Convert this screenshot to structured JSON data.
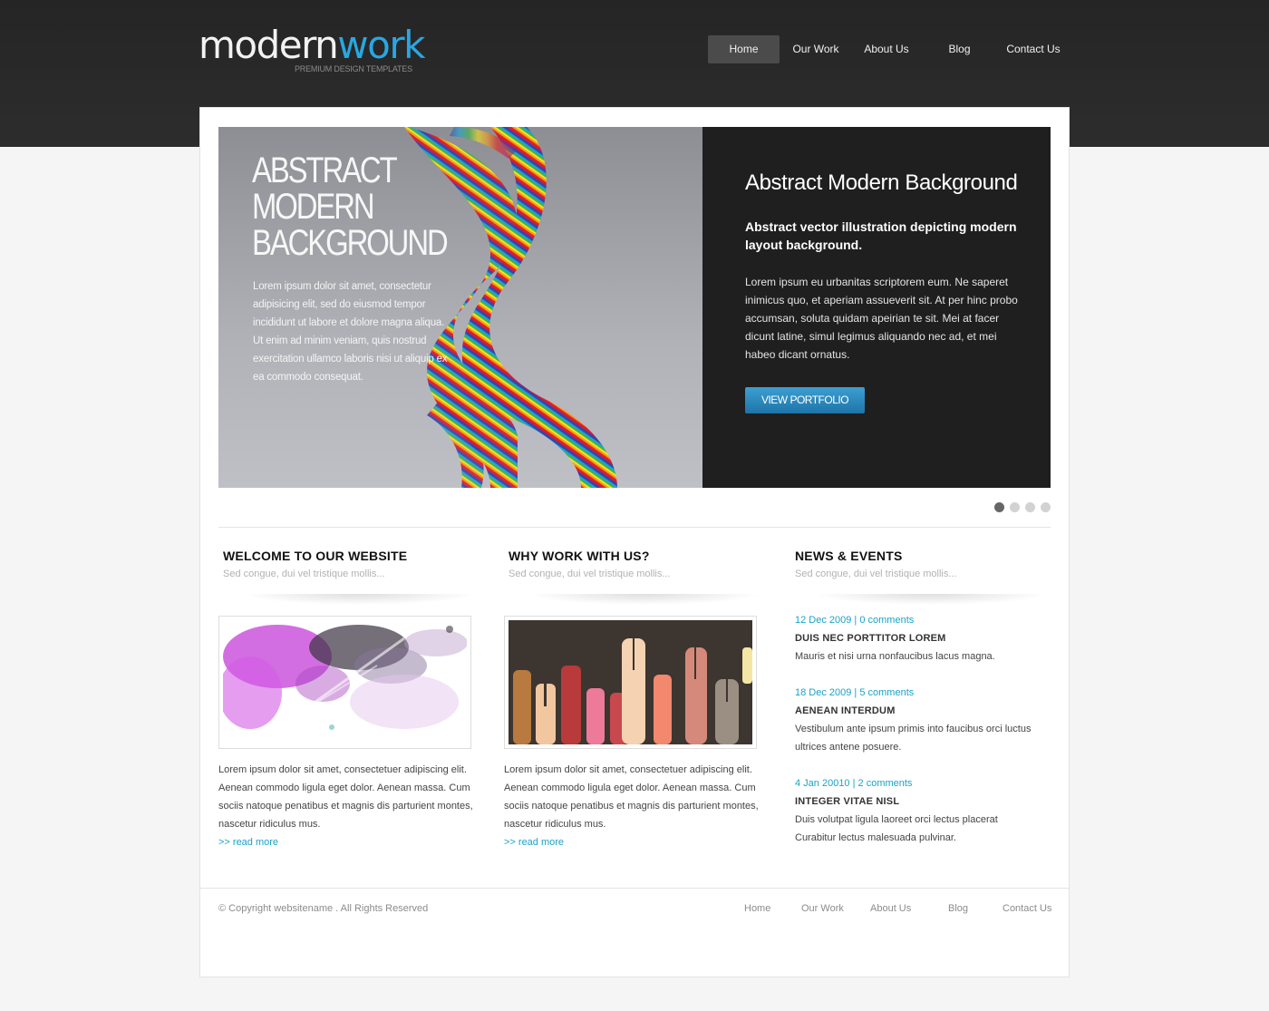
{
  "header": {
    "logo": {
      "word1": "modern",
      "word2": "work",
      "tagline": "PREMIUM DESIGN TEMPLATES"
    },
    "nav": [
      {
        "label": "Home",
        "active": true
      },
      {
        "label": "Our Work",
        "active": false
      },
      {
        "label": "About Us",
        "active": false
      },
      {
        "label": "Blog",
        "active": false
      },
      {
        "label": "Contact Us",
        "active": false
      }
    ]
  },
  "slider": {
    "image_heading": [
      "ABSTRACT",
      "MODERN",
      "BACKGROUND"
    ],
    "image_text": "Lorem ipsum dolor sit amet, consectetur adipisicing elit, sed do eiusmod tempor incididunt ut labore et dolore magna aliqua. Ut enim ad minim veniam, quis nostrud exercitation ullamco laboris nisi ut aliquip ex ea commodo consequat.",
    "title": "Abstract Modern Background",
    "subtitle": "Abstract vector illustration depicting modern layout background.",
    "description": "Lorem ipsum eu urbanitas scriptorem eum. Ne saperet inimicus quo, et aperiam assueverit sit. At per hinc probo accumsan, soluta quidam apeirian te sit. Mei at facer dicunt latine, simul legimus aliquando nec ad, et mei habeo dicant ornatus.",
    "button_label": "VIEW PORTFOLIO",
    "slide_count": 4,
    "active_slide": 1
  },
  "columns": [
    {
      "title": "WELCOME TO OUR WEBSITE",
      "subtitle": "Sed congue, dui vel tristique mollis...",
      "image": "purple-ink-splash",
      "text": "Lorem ipsum dolor sit amet, consectetuer adipiscing elit. Aenean commodo ligula eget dolor. Aenean massa. Cum sociis natoque penatibus et magnis dis parturient montes, nascetur ridiculus mus.",
      "link": ">> read more"
    },
    {
      "title": "WHY WORK WITH US?",
      "subtitle": "Sed congue, dui vel tristique mollis...",
      "image": "raised-hands",
      "text": "Lorem ipsum dolor sit amet, consectetuer adipiscing elit. Aenean commodo ligula eget dolor. Aenean massa. Cum sociis natoque penatibus et magnis dis parturient montes, nascetur ridiculus mus.",
      "link": ">> read more"
    },
    {
      "title": "NEWS & EVENTS",
      "subtitle": "Sed congue, dui vel tristique mollis..."
    }
  ],
  "news": [
    {
      "meta": "12 Dec 2009 | 0 comments",
      "title": "DUIS NEC PORTTITOR LOREM",
      "body": "Mauris et nisi urna nonfaucibus lacus magna."
    },
    {
      "meta": "18 Dec 2009 | 5 comments",
      "title": "AENEAN INTERDUM",
      "body": "Vestibulum ante ipsum primis into faucibus orci luctus ultrices antene posuere."
    },
    {
      "meta": "4 Jan 20010 | 2 comments",
      "title": "INTEGER VITAE NISL",
      "body": "Duis volutpat ligula laoreet orci lectus placerat Curabitur lectus malesuada pulvinar."
    }
  ],
  "footer": {
    "copyright": "© Copyright websitename . All Rights Reserved",
    "nav": [
      "Home",
      "Our Work",
      "About Us",
      "Blog",
      "Contact Us"
    ]
  },
  "colors": {
    "accent": "#29a7e1",
    "link": "#1aa3c9",
    "header_bg": "#2a2a2a",
    "slide_panel_bg": "#1f1f1f",
    "button": "#2a86bc"
  }
}
